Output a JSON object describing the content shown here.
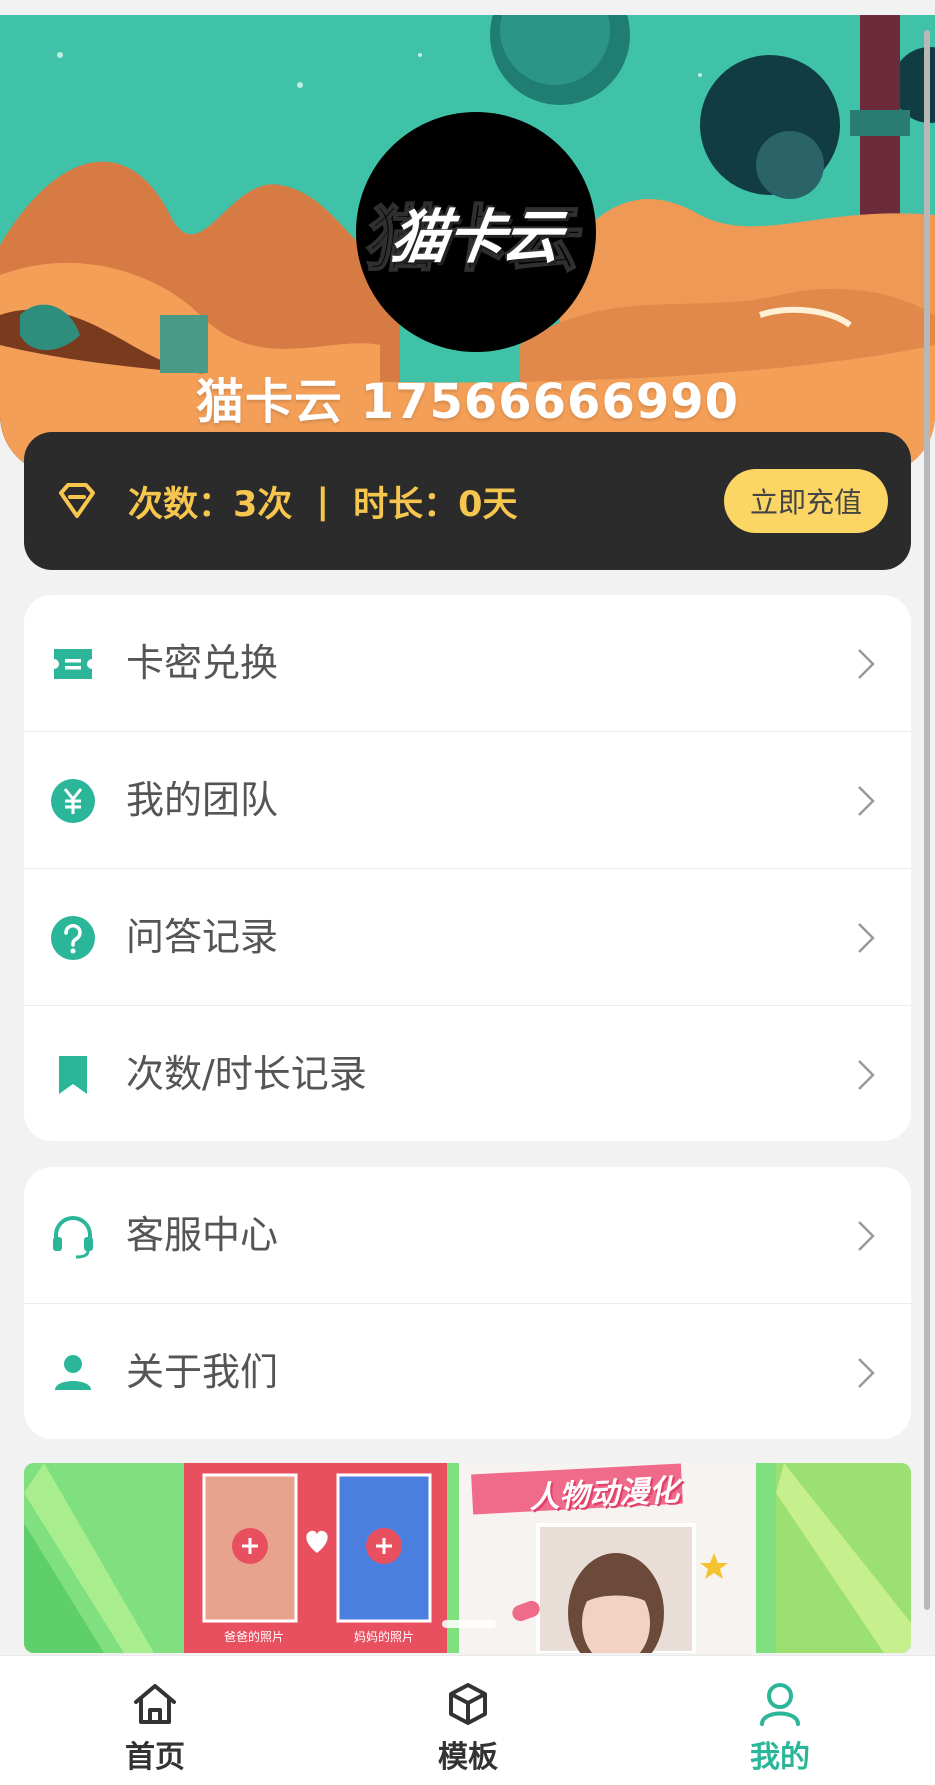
{
  "profile": {
    "avatar_text": "猫卡云",
    "username": "猫卡云 17566666990"
  },
  "stats": {
    "count": "次数：3次",
    "separator": "|",
    "duration": "时长：0天",
    "recharge_label": "立即充值",
    "icon": "diamond-icon"
  },
  "menu_main": [
    {
      "label": "卡密兑换",
      "icon": "ticket-icon"
    },
    {
      "label": "我的团队",
      "icon": "yuan-icon"
    },
    {
      "label": "问答记录",
      "icon": "question-icon"
    },
    {
      "label": "次数/时长记录",
      "icon": "bookmark-icon"
    }
  ],
  "menu_secondary": [
    {
      "label": "客服中心",
      "icon": "headset-icon"
    },
    {
      "label": "关于我们",
      "icon": "user-icon"
    }
  ],
  "banner": {
    "title": "人物动漫化",
    "caption_left": "爸爸的照片",
    "caption_right": "妈妈的照片"
  },
  "tabs": [
    {
      "label": "首页",
      "icon": "home-icon",
      "active": false
    },
    {
      "label": "模板",
      "icon": "cube-icon",
      "active": false
    },
    {
      "label": "我的",
      "icon": "person-icon",
      "active": true
    }
  ],
  "colors": {
    "accent": "#2bb69a",
    "stats_bg": "#2b2b2b",
    "stats_text": "#f6c64e",
    "recharge_bg": "#fbd664"
  }
}
